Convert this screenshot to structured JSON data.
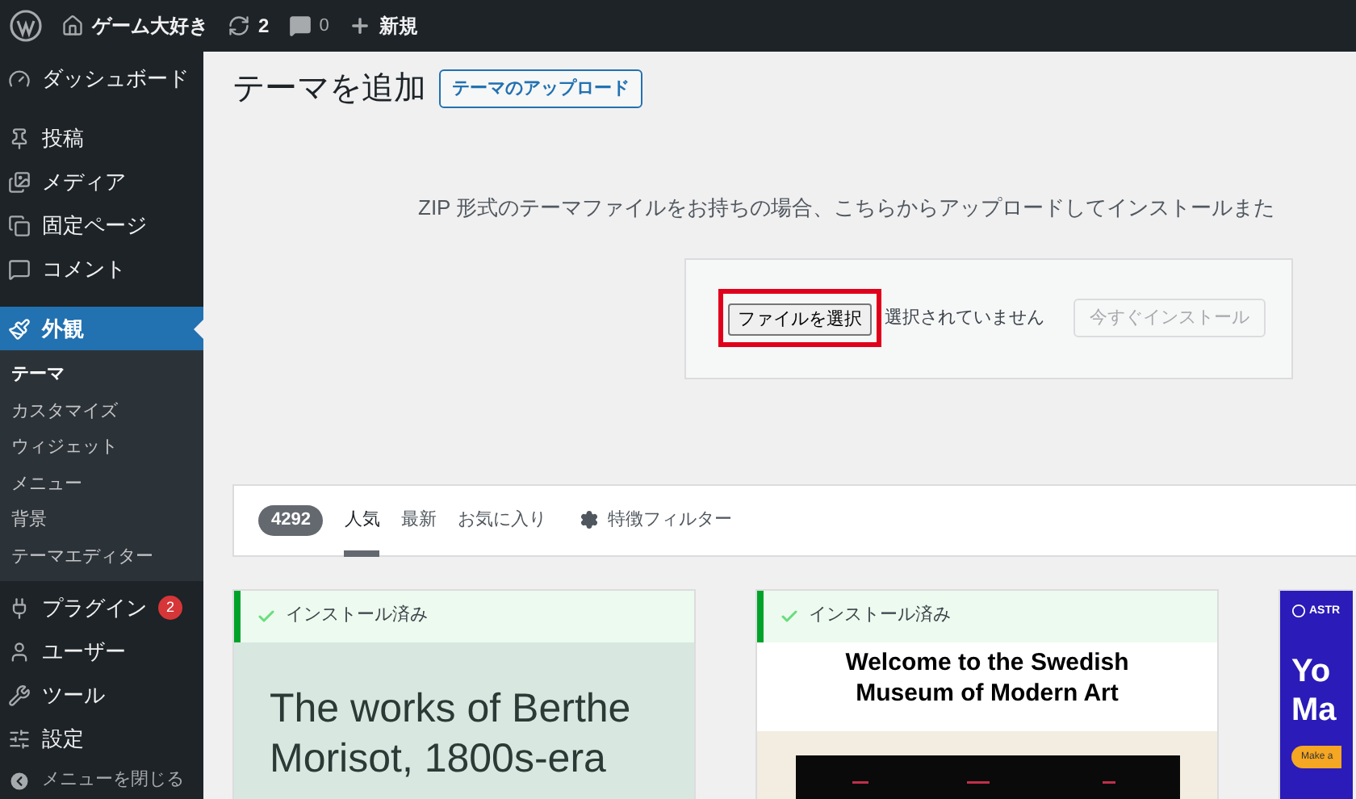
{
  "admin_bar": {
    "site_name": "ゲーム大好き",
    "updates": "2",
    "comments": "0",
    "new_label": "新規"
  },
  "sidebar": {
    "items": [
      {
        "label": "ダッシュボード",
        "selected": false
      },
      {
        "label": "投稿",
        "selected": false
      },
      {
        "label": "メディア",
        "selected": false
      },
      {
        "label": "固定ページ",
        "selected": false
      },
      {
        "label": "コメント",
        "selected": false
      },
      {
        "label": "外観",
        "selected": true,
        "children": [
          {
            "label": "テーマ",
            "selected": true
          },
          {
            "label": "カスタマイズ",
            "selected": false
          },
          {
            "label": "ウィジェット",
            "selected": false
          },
          {
            "label": "メニュー",
            "selected": false
          },
          {
            "label": "背景",
            "selected": false
          },
          {
            "label": "テーマエディター",
            "selected": false
          }
        ]
      },
      {
        "label": "プラグイン",
        "selected": false,
        "badge": "2"
      },
      {
        "label": "ユーザー",
        "selected": false
      },
      {
        "label": "ツール",
        "selected": false
      },
      {
        "label": "設定",
        "selected": false
      }
    ],
    "collapse_label": "メニューを閉じる"
  },
  "page": {
    "title": "テーマを追加",
    "upload_button": "テーマのアップロード"
  },
  "upload": {
    "description": "ZIP 形式のテーマファイルをお持ちの場合、こちらからアップロードしてインストールまた",
    "choose_button": "ファイルを選択",
    "choose_highlighted": true,
    "file_status": "選択されていません",
    "install_button": "今すぐインストール",
    "install_disabled": true
  },
  "filter_bar": {
    "count": "4292",
    "tabs": [
      {
        "label": "人気",
        "selected": true
      },
      {
        "label": "最新",
        "selected": false
      },
      {
        "label": "お気に入り",
        "selected": false
      }
    ],
    "feature_filter": "特徴フィルター"
  },
  "themes": [
    {
      "installed": true,
      "installed_label": "インストール済み",
      "preview": {
        "kind": "sans",
        "lines": [
          "The works of Berthe",
          "Morisot, 1800s-era"
        ]
      }
    },
    {
      "installed": true,
      "installed_label": "インストール済み",
      "preview": {
        "kind": "museum",
        "lines": [
          "Welcome to the Swedish",
          "Museum of Modern Art"
        ]
      }
    },
    {
      "installed": false,
      "preview": {
        "kind": "astra",
        "logo": "ASTR",
        "lines": [
          "Yo",
          "Ma"
        ],
        "button": "Make a"
      }
    }
  ]
}
